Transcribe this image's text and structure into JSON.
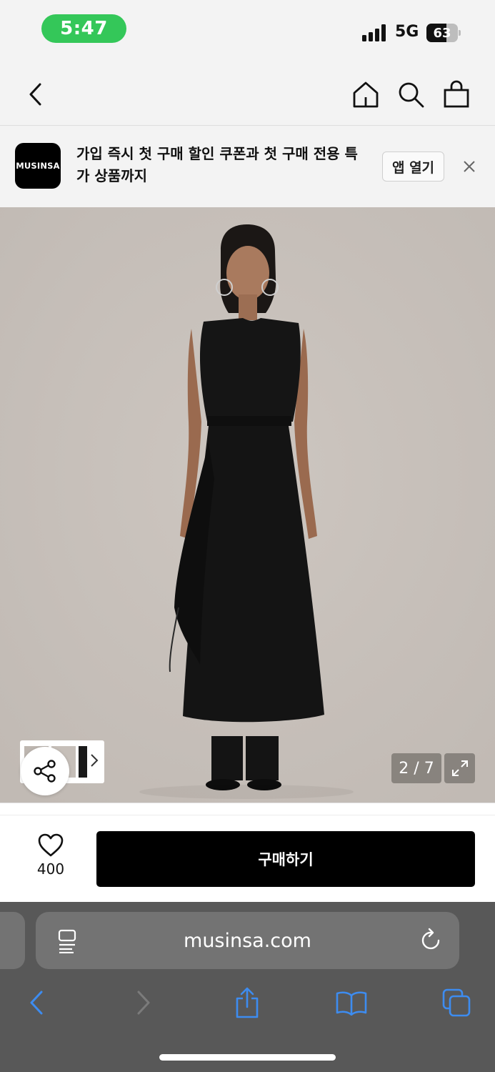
{
  "status_bar": {
    "time": "5:47",
    "network": "5G",
    "battery_percent": 63,
    "battery_label": "63",
    "time_pill_color": "#34c759"
  },
  "nav": {
    "back_icon": "chevron-left-icon",
    "home_icon": "home-icon",
    "search_icon": "search-icon",
    "cart_icon": "shopping-bag-icon"
  },
  "banner": {
    "logo_text": "MUSINSA",
    "message": "가입 즉시 첫 구매 할인 쿠폰과 첫 구매 전용 특가 상품까지",
    "open_app_label": "앱 열기",
    "close_icon": "close-icon"
  },
  "gallery": {
    "page_counter": "2 / 7",
    "share_icon": "share-icon",
    "expand_icon": "expand-icon",
    "thumb_next_icon": "chevron-right-icon"
  },
  "buy_bar": {
    "like_icon": "heart-icon",
    "like_count": "400",
    "buy_label": "구매하기"
  },
  "safari": {
    "url": "musinsa.com",
    "reader_icon": "reader-icon",
    "reload_icon": "reload-icon",
    "toolbar_icons": [
      "back-icon",
      "forward-icon",
      "share-icon",
      "bookmarks-icon",
      "tabs-icon"
    ],
    "accent_color": "#3d8cf0"
  }
}
